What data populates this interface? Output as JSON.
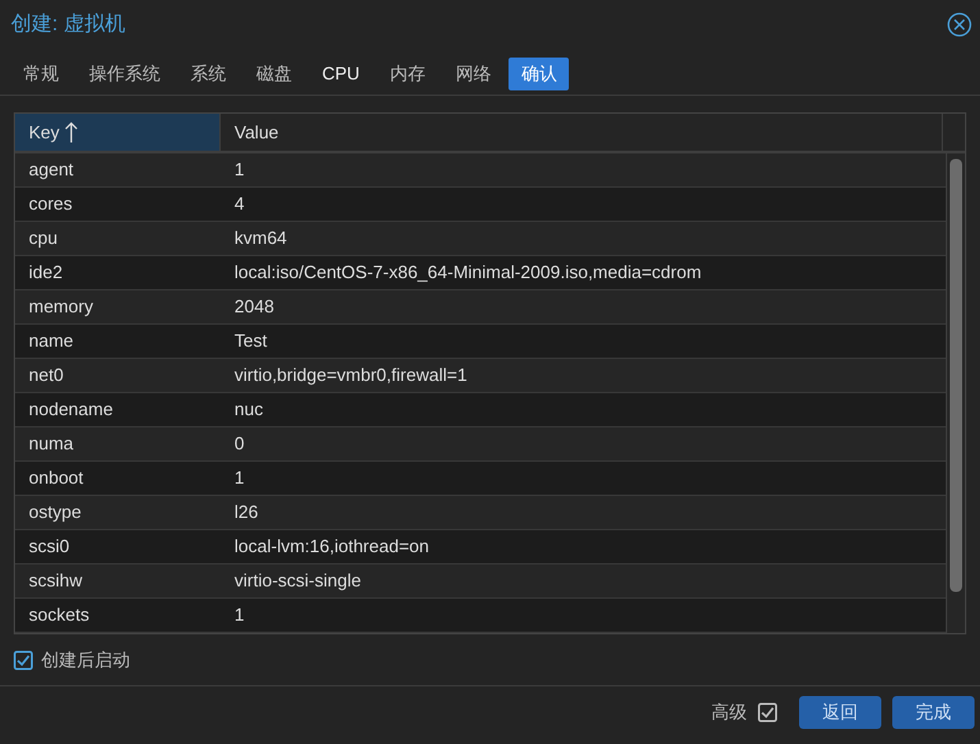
{
  "window": {
    "title": "创建: 虚拟机"
  },
  "tabs": [
    {
      "label": "常规",
      "selected": false,
      "hovered": false
    },
    {
      "label": "操作系统",
      "selected": false,
      "hovered": false
    },
    {
      "label": "系统",
      "selected": false,
      "hovered": false
    },
    {
      "label": "磁盘",
      "selected": false,
      "hovered": false
    },
    {
      "label": "CPU",
      "selected": false,
      "hovered": true
    },
    {
      "label": "内存",
      "selected": false,
      "hovered": false
    },
    {
      "label": "网络",
      "selected": false,
      "hovered": false
    },
    {
      "label": "确认",
      "selected": true,
      "hovered": false
    }
  ],
  "table": {
    "columns": [
      {
        "label": "Key",
        "sorted": true
      },
      {
        "label": "Value",
        "sorted": false
      }
    ],
    "rows": [
      [
        "agent",
        "1"
      ],
      [
        "cores",
        "4"
      ],
      [
        "cpu",
        "kvm64"
      ],
      [
        "ide2",
        "local:iso/CentOS-7-x86_64-Minimal-2009.iso,media=cdrom"
      ],
      [
        "memory",
        "2048"
      ],
      [
        "name",
        "Test"
      ],
      [
        "net0",
        "virtio,bridge=vmbr0,firewall=1"
      ],
      [
        "nodename",
        "nuc"
      ],
      [
        "numa",
        "0"
      ],
      [
        "onboot",
        "1"
      ],
      [
        "ostype",
        "l26"
      ],
      [
        "scsi0",
        "local-lvm:16,iothread=on"
      ],
      [
        "scsihw",
        "virtio-scsi-single"
      ],
      [
        "sockets",
        "1"
      ]
    ]
  },
  "start_after_create": {
    "label": "创建后启动",
    "checked": true
  },
  "footer": {
    "advanced": {
      "label": "高级",
      "checked": true
    },
    "buttons": [
      "返回",
      "完成"
    ]
  }
}
